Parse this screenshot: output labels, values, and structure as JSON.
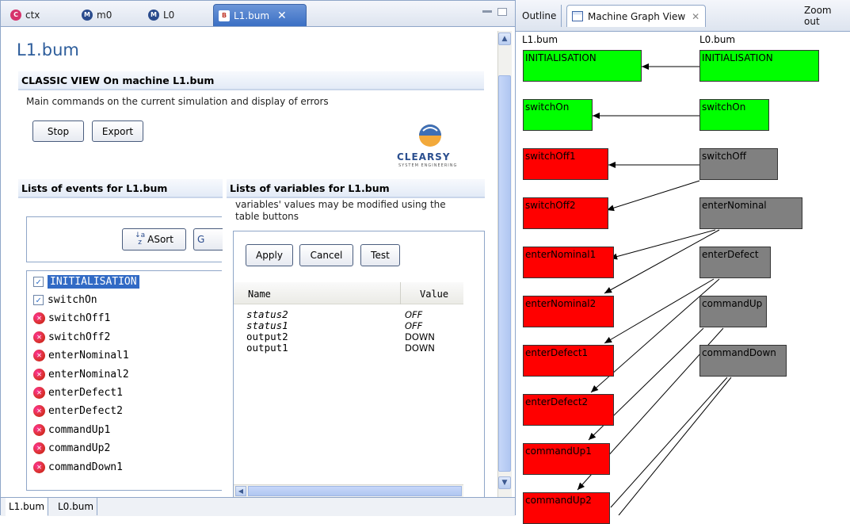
{
  "editor_tabs": [
    {
      "label": "ctx",
      "icon": "context-icon",
      "color": "#d6336c"
    },
    {
      "label": "m0",
      "icon": "machine-icon",
      "color": "#2a4b8d"
    },
    {
      "label": "L0",
      "icon": "machine-icon",
      "color": "#2a4b8d"
    },
    {
      "label": "L1.bum",
      "icon": "bum-file-icon",
      "color": "#c0392b",
      "active": true
    }
  ],
  "editor": {
    "title": "L1.bum",
    "classic_view": {
      "heading": "CLASSIC VIEW On machine L1.bum",
      "description": "Main commands on the current simulation and display of errors",
      "stop_label": "Stop",
      "export_label": "Export",
      "logo_text": "CLEARSY",
      "logo_subtext": "SYSTEM ENGINEERING"
    },
    "events": {
      "heading": "Lists of events for L1.bum",
      "sort_label": "ASort",
      "sort2_label": "G",
      "items": [
        {
          "label": "INITIALISATION",
          "state": "checked",
          "selected": true
        },
        {
          "label": "switchOn",
          "state": "checked"
        },
        {
          "label": "switchOff1",
          "state": "error"
        },
        {
          "label": "switchOff2",
          "state": "error"
        },
        {
          "label": "enterNominal1",
          "state": "error"
        },
        {
          "label": "enterNominal2",
          "state": "error"
        },
        {
          "label": "enterDefect1",
          "state": "error"
        },
        {
          "label": "enterDefect2",
          "state": "error"
        },
        {
          "label": "commandUp1",
          "state": "error"
        },
        {
          "label": "commandUp2",
          "state": "error"
        },
        {
          "label": "commandDown1",
          "state": "error"
        }
      ]
    },
    "variables": {
      "heading": "Lists of variables for L1.bum",
      "description_line1": "variables' values may be modified using the",
      "description_line2": "table buttons",
      "apply_label": "Apply",
      "cancel_label": "Cancel",
      "test_label": "Test",
      "columns": [
        "Name",
        "Value"
      ],
      "rows": [
        {
          "name": "status2",
          "value": "OFF",
          "italic": true
        },
        {
          "name": "status1",
          "value": "OFF",
          "italic": true
        },
        {
          "name": "output2",
          "value": "DOWN",
          "italic": false
        },
        {
          "name": "output1",
          "value": "DOWN",
          "italic": false
        }
      ]
    },
    "bottom_tabs": [
      "L1.bum",
      "L0.bum"
    ]
  },
  "graph_view": {
    "tabs": [
      "Outline",
      "Machine Graph View",
      "Zoom out"
    ],
    "columns": [
      "L1.bum",
      "L0.bum"
    ],
    "left_nodes": [
      {
        "label": "INITIALISATION",
        "color": "green"
      },
      {
        "label": "switchOn",
        "color": "green"
      },
      {
        "label": "switchOff1",
        "color": "red"
      },
      {
        "label": "switchOff2",
        "color": "red"
      },
      {
        "label": "enterNominal1",
        "color": "red"
      },
      {
        "label": "enterNominal2",
        "color": "red"
      },
      {
        "label": "enterDefect1",
        "color": "red"
      },
      {
        "label": "enterDefect2",
        "color": "red"
      },
      {
        "label": "commandUp1",
        "color": "red"
      },
      {
        "label": "commandUp2",
        "color": "red"
      }
    ],
    "right_nodes": [
      {
        "label": "INITIALISATION",
        "color": "green"
      },
      {
        "label": "switchOn",
        "color": "green"
      },
      {
        "label": "switchOff",
        "color": "gray"
      },
      {
        "label": "enterNominal",
        "color": "gray"
      },
      {
        "label": "enterDefect",
        "color": "gray"
      },
      {
        "label": "commandUp",
        "color": "gray"
      },
      {
        "label": "commandDown",
        "color": "gray"
      }
    ],
    "colors": {
      "green": "#00ff00",
      "red": "#ff0000",
      "gray": "#808080"
    }
  }
}
